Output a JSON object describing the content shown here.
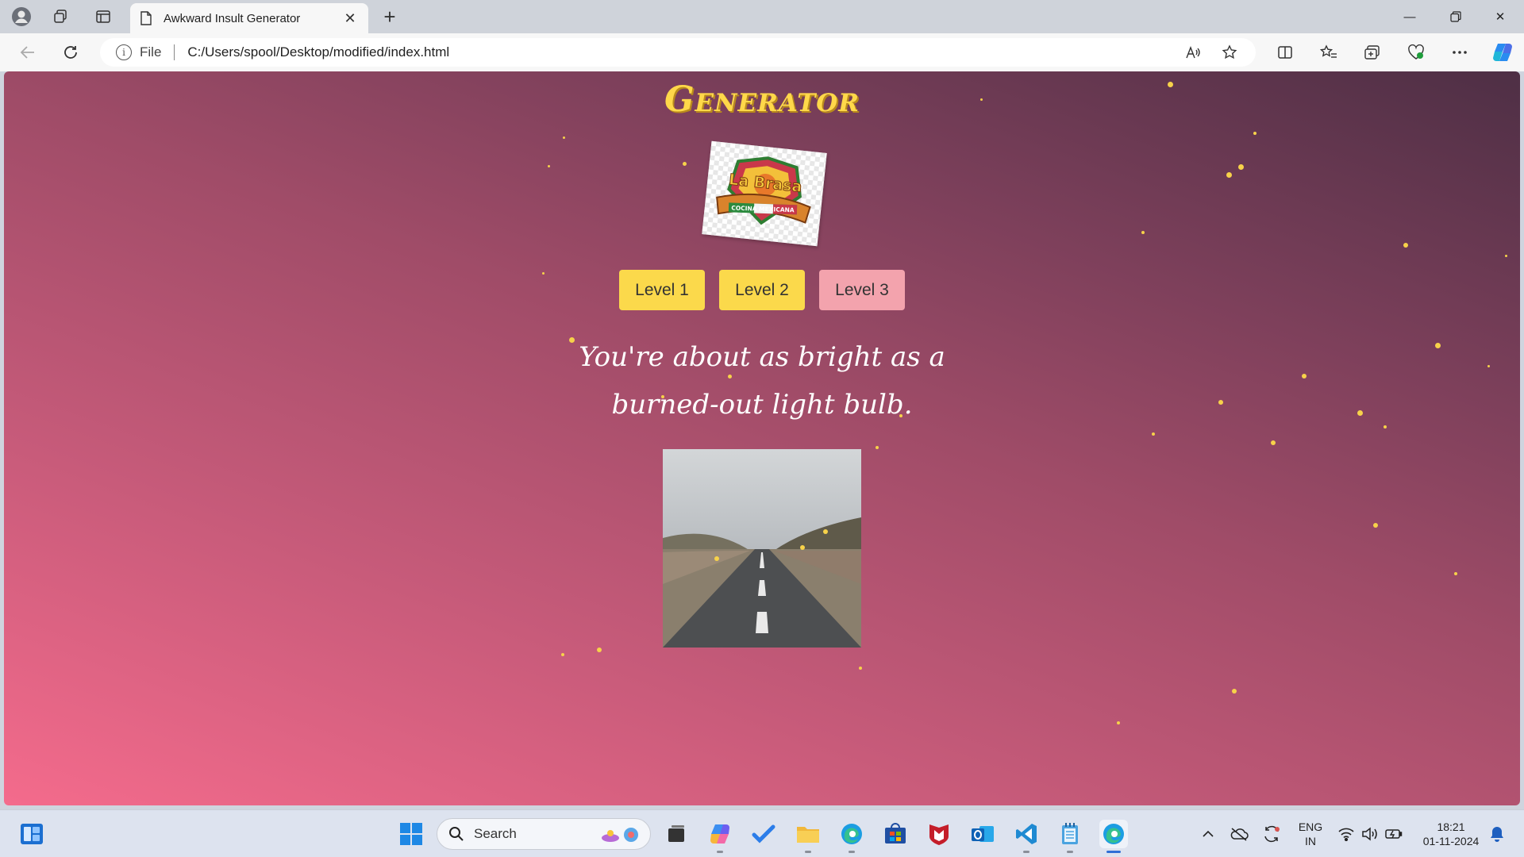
{
  "browser": {
    "tab_title": "Awkward Insult Generator",
    "address_prefix": "File",
    "url": "C:/Users/spool/Desktop/modified/index.html"
  },
  "page": {
    "title": "Generator",
    "logo": {
      "name": "La Brasa",
      "tagline": "COCINA MEXICANA"
    },
    "buttons": [
      "Level 1",
      "Level 2",
      "Level 3"
    ],
    "active_level": "Level 3",
    "insult": "You're about as bright as a burned-out light bulb.",
    "colors": {
      "title": "#ffd84a",
      "button": "#fbd94b",
      "button_active": "#f3a3ad",
      "star": "#f7d24a"
    }
  },
  "taskbar": {
    "search_placeholder": "Search",
    "language": "ENG",
    "region": "IN",
    "time": "18:21",
    "date": "01-11-2024",
    "pinned_icons": [
      "windows-start-icon",
      "widgets-icon",
      "task-view-icon",
      "copilot-icon",
      "todo-icon",
      "file-explorer-icon",
      "edge-icon",
      "store-icon",
      "mcafee-icon",
      "outlook-icon",
      "vscode-icon",
      "notepad-icon",
      "edge-active-icon"
    ]
  }
}
